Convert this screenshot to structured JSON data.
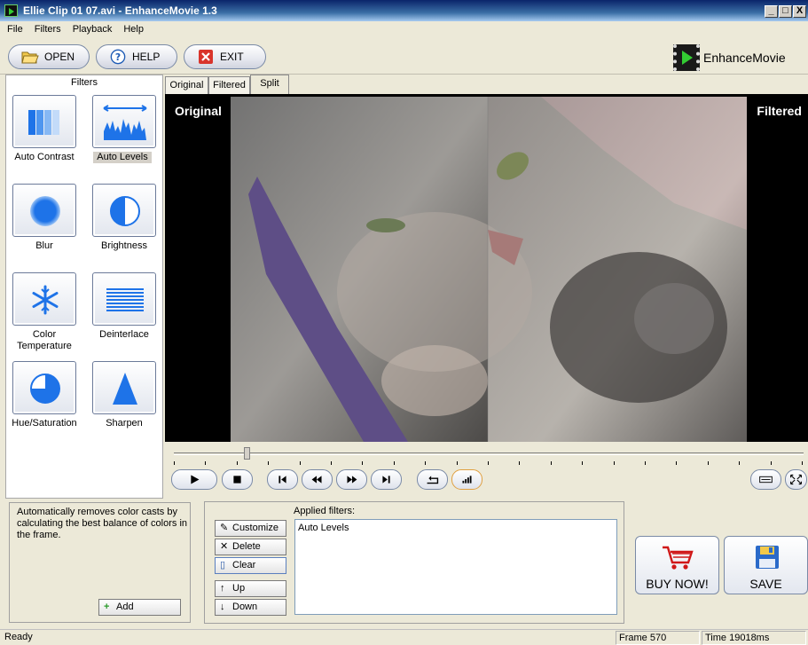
{
  "window": {
    "title": "Ellie Clip 01 07.avi - EnhanceMovie 1.3",
    "min": "_",
    "max": "□",
    "close": "X"
  },
  "menu": [
    "File",
    "Filters",
    "Playback",
    "Help"
  ],
  "toolbar": {
    "open": "OPEN",
    "help": "HELP",
    "exit": "EXIT",
    "logo": "EnhanceMovie"
  },
  "filters": {
    "header": "Filters",
    "items": [
      {
        "label": "Auto Contrast",
        "icon": "auto-contrast-icon"
      },
      {
        "label": "Auto Levels",
        "icon": "auto-levels-icon",
        "selected": true
      },
      {
        "label": "Blur",
        "icon": "blur-icon"
      },
      {
        "label": "Brightness",
        "icon": "brightness-icon"
      },
      {
        "label": "Color Temperature",
        "icon": "snowflake-icon"
      },
      {
        "label": "Deinterlace",
        "icon": "deinterlace-icon"
      },
      {
        "label": "Hue/Saturation",
        "icon": "hue-saturation-icon"
      },
      {
        "label": "Sharpen",
        "icon": "sharpen-icon"
      }
    ]
  },
  "view_tabs": [
    {
      "label": "Original"
    },
    {
      "label": "Filtered"
    },
    {
      "label": "Split",
      "active": true
    }
  ],
  "video": {
    "left_label": "Original",
    "right_label": "Filtered"
  },
  "seek": {
    "position_fraction": 0.115
  },
  "description": "Automatically removes color casts by calculating the best balance of colors in the frame.",
  "buttons": {
    "add": "Add",
    "customize": "Customize",
    "delete": "Delete",
    "clear": "Clear",
    "up": "Up",
    "down": "Down"
  },
  "applied": {
    "label": "Applied filters:",
    "items": [
      "Auto Levels"
    ]
  },
  "actions": {
    "buy": "BUY NOW!",
    "save": "SAVE"
  },
  "status": {
    "state": "Ready",
    "frame": "Frame 570",
    "time": "Time 19018ms"
  },
  "colors": {
    "accent_blue": "#1e73e8",
    "exit_red": "#d9342b",
    "cart_red": "#d01818"
  }
}
